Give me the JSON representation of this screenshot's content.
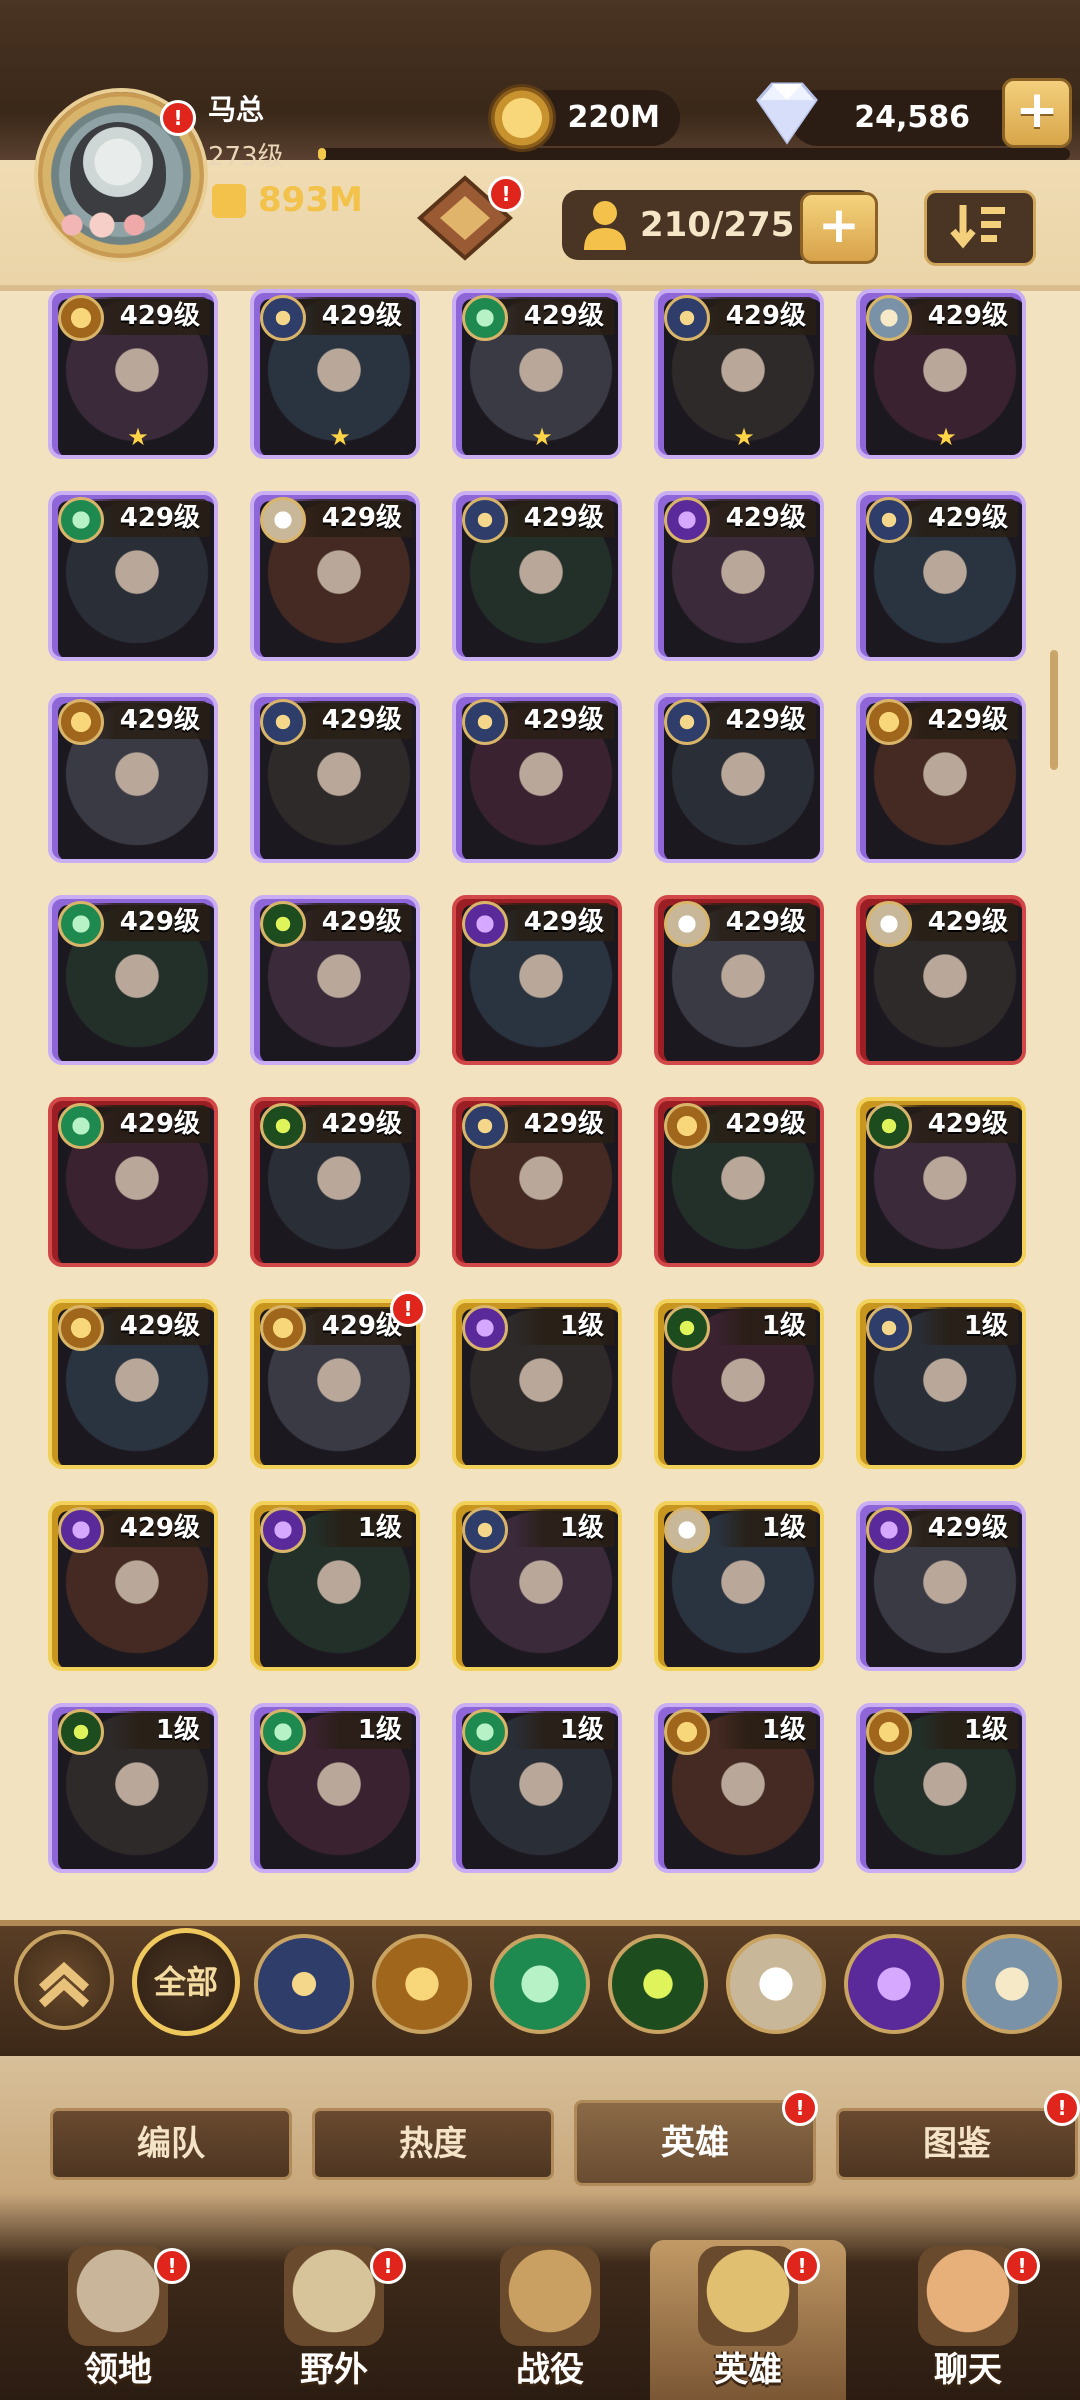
{
  "player": {
    "name": "马总",
    "level": "273级",
    "power": "893M",
    "avatar_badge": "!"
  },
  "currency": {
    "gold": "220M",
    "gems": "24,586"
  },
  "hero_count": "210/275",
  "icons": {
    "gold": "gold-coin-icon",
    "gem": "diamond-icon",
    "plus": "+",
    "fist": "fist-icon",
    "sort": "sort-icon",
    "person": "person-icon",
    "star": "★",
    "scroll_up": "double-chevron-up-icon"
  },
  "badge": "!",
  "heroes": [
    {
      "level": "429级",
      "rarity": "purple",
      "faction": "gold",
      "stars": 1
    },
    {
      "level": "429级",
      "rarity": "purple",
      "faction": "blue",
      "stars": 1
    },
    {
      "level": "429级",
      "rarity": "purple",
      "faction": "green",
      "stars": 1
    },
    {
      "level": "429级",
      "rarity": "purple",
      "faction": "blue",
      "stars": 1
    },
    {
      "level": "429级",
      "rarity": "purple",
      "faction": "silver",
      "stars": 1
    },
    {
      "level": "429级",
      "rarity": "purple",
      "faction": "green",
      "stars": 0
    },
    {
      "level": "429级",
      "rarity": "purple",
      "faction": "white",
      "stars": 0
    },
    {
      "level": "429级",
      "rarity": "purple",
      "faction": "blue",
      "stars": 0
    },
    {
      "level": "429级",
      "rarity": "purple",
      "faction": "purple",
      "stars": 0
    },
    {
      "level": "429级",
      "rarity": "purple",
      "faction": "blue",
      "stars": 0
    },
    {
      "level": "429级",
      "rarity": "purple",
      "faction": "gold",
      "stars": 0
    },
    {
      "level": "429级",
      "rarity": "purple",
      "faction": "blue",
      "stars": 0
    },
    {
      "level": "429级",
      "rarity": "purple",
      "faction": "blue",
      "stars": 0
    },
    {
      "level": "429级",
      "rarity": "purple",
      "faction": "blue",
      "stars": 0
    },
    {
      "level": "429级",
      "rarity": "purple",
      "faction": "gold",
      "stars": 0
    },
    {
      "level": "429级",
      "rarity": "purple",
      "faction": "green",
      "stars": 0
    },
    {
      "level": "429级",
      "rarity": "purple",
      "faction": "eye",
      "stars": 0
    },
    {
      "level": "429级",
      "rarity": "red",
      "faction": "purple",
      "stars": 0
    },
    {
      "level": "429级",
      "rarity": "red",
      "faction": "white",
      "stars": 0
    },
    {
      "level": "429级",
      "rarity": "red",
      "faction": "white",
      "stars": 0
    },
    {
      "level": "429级",
      "rarity": "red",
      "faction": "green",
      "stars": 0
    },
    {
      "level": "429级",
      "rarity": "red",
      "faction": "eye",
      "stars": 0
    },
    {
      "level": "429级",
      "rarity": "red",
      "faction": "blue",
      "stars": 0
    },
    {
      "level": "429级",
      "rarity": "red",
      "faction": "gold",
      "stars": 0
    },
    {
      "level": "429级",
      "rarity": "gold",
      "faction": "eye",
      "stars": 0
    },
    {
      "level": "429级",
      "rarity": "gold",
      "faction": "gold",
      "stars": 0
    },
    {
      "level": "429级",
      "rarity": "gold",
      "faction": "gold",
      "stars": 0,
      "alert": true
    },
    {
      "level": "1级",
      "rarity": "gold",
      "faction": "purple",
      "stars": 0
    },
    {
      "level": "1级",
      "rarity": "gold",
      "faction": "eye",
      "stars": 0
    },
    {
      "level": "1级",
      "rarity": "gold",
      "faction": "blue",
      "stars": 0
    },
    {
      "level": "429级",
      "rarity": "gold",
      "faction": "purple",
      "stars": 0
    },
    {
      "level": "1级",
      "rarity": "gold",
      "faction": "purple",
      "stars": 0
    },
    {
      "level": "1级",
      "rarity": "gold",
      "faction": "blue",
      "stars": 0
    },
    {
      "level": "1级",
      "rarity": "gold",
      "faction": "white",
      "stars": 0
    },
    {
      "level": "429级",
      "rarity": "purple",
      "faction": "purple",
      "stars": 0
    },
    {
      "level": "1级",
      "rarity": "purple",
      "faction": "eye",
      "stars": 0
    },
    {
      "level": "1级",
      "rarity": "purple",
      "faction": "green",
      "stars": 0
    },
    {
      "level": "1级",
      "rarity": "purple",
      "faction": "green",
      "stars": 0
    },
    {
      "level": "1级",
      "rarity": "purple",
      "faction": "gold",
      "stars": 0
    },
    {
      "level": "1级",
      "rarity": "purple",
      "faction": "gold",
      "stars": 0
    }
  ],
  "filters": {
    "all_label": "全部",
    "factions": [
      "blue",
      "gold",
      "green",
      "eye",
      "white",
      "purple",
      "silver"
    ]
  },
  "tabs": [
    {
      "label": "编队",
      "alert": false
    },
    {
      "label": "热度",
      "alert": false
    },
    {
      "label": "英雄",
      "alert": true,
      "active": true
    },
    {
      "label": "图鉴",
      "alert": true
    }
  ],
  "nav": [
    {
      "label": "领地",
      "icon": "castle-icon",
      "alert": true
    },
    {
      "label": "野外",
      "icon": "map-scroll-icon",
      "alert": true
    },
    {
      "label": "战役",
      "icon": "sword-shield-icon",
      "alert": false
    },
    {
      "label": "英雄",
      "icon": "helmet-icon",
      "alert": true,
      "active": true
    },
    {
      "label": "聊天",
      "icon": "chat-bubble-icon",
      "alert": true
    }
  ],
  "colors": {
    "rarity_purple": "#8e66d8",
    "rarity_red": "#9a1e24",
    "rarity_gold": "#c8951e",
    "badge_red": "#e0261c",
    "accent_gold": "#f3c24a"
  }
}
